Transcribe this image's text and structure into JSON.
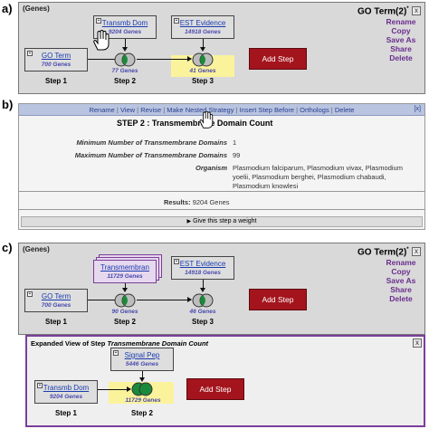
{
  "panels": {
    "a": {
      "label": "a)",
      "genes_tag": "(Genes)",
      "title": "GO Term(2)",
      "title_sup": "*",
      "close": "x",
      "menu": [
        "Rename",
        "Copy",
        "Save As",
        "Share",
        "Delete"
      ],
      "steps": [
        {
          "link": "GO Term",
          "count": "700 Genes",
          "label": "Step 1"
        },
        {
          "link": "Transmb Dom",
          "count": "9204 Genes",
          "result": "77 Genes",
          "label": "Step 2"
        },
        {
          "link": "EST Evidence",
          "count": "14918 Genes",
          "result": "41 Genes",
          "label": "Step 3"
        }
      ],
      "add_step": "Add Step"
    },
    "b": {
      "label": "b)",
      "menu": [
        "Rename",
        "View",
        "Revise",
        "Make Nested Strategy",
        "Insert Step Before",
        "Orthologs",
        "Delete"
      ],
      "close": "[x]",
      "title": "STEP 2 : Transmembrane Domain Count",
      "params": [
        {
          "key": "Minimum Number of Transmembrane Domains",
          "value": "1"
        },
        {
          "key": "Maximum Number of Transmembrane Domains",
          "value": "99"
        },
        {
          "key": "Organism",
          "value": "Plasmodium falciparum, Plasmodium vivax, Plasmodium yoelii, Plasmodium berghei, Plasmodium chabaudi, Plasmodium knowlesi"
        }
      ],
      "results_label": "Results:",
      "results_value": "9204 Genes",
      "weight": "Give this step a weight"
    },
    "c": {
      "label": "c)",
      "genes_tag": "(Genes)",
      "title": "GO Term(2)",
      "title_sup": "*",
      "close": "x",
      "menu": [
        "Rename",
        "Copy",
        "Save As",
        "Share",
        "Delete"
      ],
      "steps": [
        {
          "link": "GO Term",
          "count": "700 Genes",
          "label": "Step 1"
        },
        {
          "link": "Transmembran",
          "count": "11729 Genes",
          "result": "90 Genes",
          "label": "Step 2"
        },
        {
          "link": "EST Evidence",
          "count": "14918 Genes",
          "result": "46 Genes",
          "label": "Step 3"
        }
      ],
      "add_step": "Add Step",
      "expanded": {
        "title_prefix": "Expanded View of Step ",
        "title_name": "Transmembrane Domain Count",
        "close": "x",
        "steps": [
          {
            "link": "Transmb Dom",
            "count": "9204 Genes",
            "label": "Step 1"
          },
          {
            "link": "Signal Pep",
            "count": "5446 Genes",
            "result": "11729 Genes",
            "label": "Step 2"
          }
        ],
        "add_step": "Add Step"
      }
    }
  },
  "colors": {
    "add_step": "#a3141c",
    "link": "#1a3cb0",
    "menu": "#6a2e8e",
    "highlight": "#fbf39c",
    "venn": "#1a8a3a",
    "expanded_border": "#7b3e9a"
  }
}
